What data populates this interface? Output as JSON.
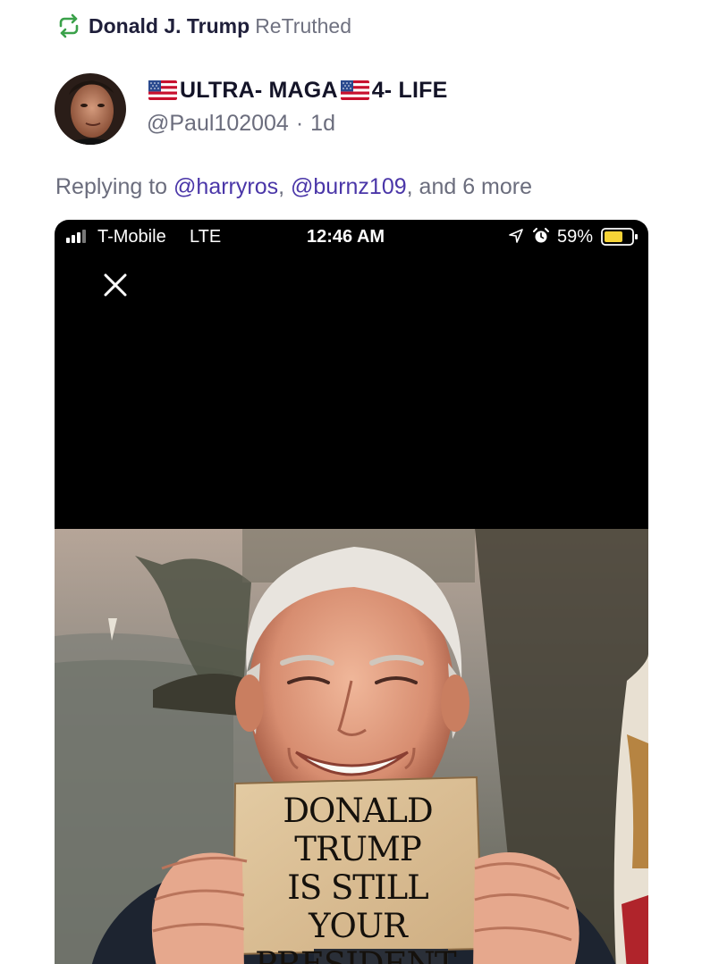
{
  "retruth": {
    "author": "Donald J. Trump",
    "label": "ReTruthed",
    "icon": "retruth-icon",
    "icon_color": "#3aa14a"
  },
  "post": {
    "display_name_part1": "ULTRA- MAGA",
    "display_name_part2": "4- LIFE",
    "flag_icon": "us-flag-icon",
    "handle": "@Paul102004",
    "separator": "·",
    "age": "1d",
    "replying_prefix": "Replying to",
    "replying_mentions": [
      "@harryros",
      "@burnz109"
    ],
    "replying_suffix": ", and 6 more",
    "mention_color": "#4a36a8"
  },
  "media": {
    "status_bar": {
      "carrier": "T-Mobile",
      "network": "LTE",
      "time": "12:46 AM",
      "battery_percent": "59%",
      "battery_color": "#f5d337"
    },
    "close_icon": "close-icon",
    "sign_lines": [
      "DONALD TRUMP",
      "IS STILL YOUR",
      "PRESIDENT."
    ]
  }
}
